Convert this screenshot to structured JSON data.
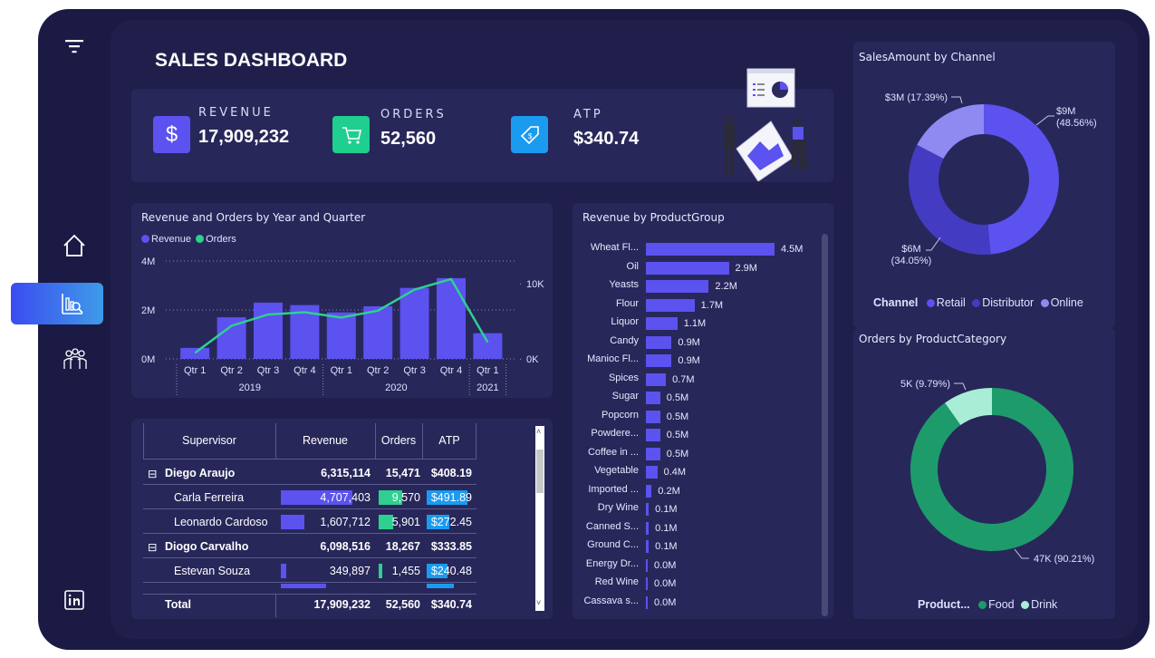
{
  "title": "SALES DASHBOARD",
  "kpis": [
    {
      "label": "REVENUE",
      "value": "17,909,232",
      "icon": "dollar-icon",
      "color": "#5b52f0"
    },
    {
      "label": "ORDERS",
      "value": "52,560",
      "icon": "cart-icon",
      "color": "#1fcf8f"
    },
    {
      "label": "ATP",
      "value": "$340.74",
      "icon": "price-tag-icon",
      "color": "#1a9bf0"
    }
  ],
  "colors": {
    "revenue": "#5b52f0",
    "orders": "#2fd08f",
    "food": "#1e9b6b",
    "drink": "#a8eed6",
    "retail": "#5b52f0",
    "distributor": "#433cc2",
    "online": "#8f8af2"
  },
  "combo": {
    "title": "Revenue and Orders by Year and Quarter",
    "legend": [
      "Revenue",
      "Orders"
    ],
    "left_axis": [
      "4M",
      "2M",
      "0M"
    ],
    "right_axis": [
      "10K",
      "0K"
    ],
    "quarters": [
      "Qtr 1",
      "Qtr 2",
      "Qtr 3",
      "Qtr 4",
      "Qtr 1",
      "Qtr 2",
      "Qtr 3",
      "Qtr 4",
      "Qtr 1"
    ],
    "years": [
      "2019",
      "2020",
      "2021"
    ]
  },
  "chart_data": [
    {
      "type": "bar",
      "title": "Revenue and Orders by Year and Quarter",
      "categories": [
        "2019 Qtr 1",
        "2019 Qtr 2",
        "2019 Qtr 3",
        "2019 Qtr 4",
        "2020 Qtr 1",
        "2020 Qtr 2",
        "2020 Qtr 3",
        "2020 Qtr 4",
        "2021 Qtr 1"
      ],
      "series": [
        {
          "name": "Revenue",
          "values": [
            450000,
            1700000,
            2300000,
            2200000,
            1900000,
            2150000,
            2900000,
            3300000,
            1050000
          ]
        },
        {
          "name": "Orders",
          "values": [
            800,
            4400,
            5900,
            6200,
            5500,
            6400,
            9200,
            10600,
            2200
          ]
        }
      ],
      "ylim": [
        0,
        4000000
      ],
      "y2lim": [
        0,
        13000
      ]
    },
    {
      "type": "bar",
      "title": "Revenue by ProductGroup",
      "categories": [
        "Wheat Fl...",
        "Oil",
        "Yeasts",
        "Flour",
        "Liquor",
        "Candy",
        "Manioc Fl...",
        "Spices",
        "Sugar",
        "Popcorn",
        "Powdere...",
        "Coffee in ...",
        "Vegetable",
        "Imported ...",
        "Dry Wine",
        "Canned S...",
        "Ground C...",
        "Energy Dr...",
        "Red Wine",
        "Cassava s..."
      ],
      "values": [
        4.5,
        2.9,
        2.2,
        1.7,
        1.1,
        0.9,
        0.9,
        0.7,
        0.5,
        0.5,
        0.5,
        0.5,
        0.4,
        0.2,
        0.1,
        0.1,
        0.1,
        0.0,
        0.0,
        0.0
      ],
      "labels": [
        "4.5M",
        "2.9M",
        "2.2M",
        "1.7M",
        "1.1M",
        "0.9M",
        "0.9M",
        "0.7M",
        "0.5M",
        "0.5M",
        "0.5M",
        "0.5M",
        "0.4M",
        "0.2M",
        "0.1M",
        "0.1M",
        "0.1M",
        "0.0M",
        "0.0M",
        "0.0M"
      ]
    },
    {
      "type": "pie",
      "title": "SalesAmount by Channel",
      "categories": [
        "Retail",
        "Distributor",
        "Online"
      ],
      "values": [
        48.56,
        34.05,
        17.39
      ],
      "labels": [
        "$9M (48.56%)",
        "$6M (34.05%)",
        "$3M (17.39%)"
      ],
      "legend_title": "Channel"
    },
    {
      "type": "pie",
      "title": "Orders by ProductCategory",
      "categories": [
        "Food",
        "Drink"
      ],
      "values": [
        90.21,
        9.79
      ],
      "labels": [
        "47K (90.21%)",
        "5K (9.79%)"
      ],
      "legend_title": "Product..."
    }
  ],
  "table": {
    "headers": [
      "Supervisor",
      "Revenue",
      "Orders",
      "ATP"
    ],
    "rows": [
      {
        "name": "Diego Araujo",
        "revenue": "6,315,114",
        "orders": "15,471",
        "atp": "$408.19",
        "group": true,
        "r": 0,
        "o": 0,
        "a": 0
      },
      {
        "name": "Carla Ferreira",
        "revenue": "4,707,403",
        "orders": "9,570",
        "atp": "$491.89",
        "group": false,
        "r": 0.72,
        "o": 0.72,
        "a": 0.9
      },
      {
        "name": "Leonardo Cardoso",
        "revenue": "1,607,712",
        "orders": "5,901",
        "atp": "$272.45",
        "group": false,
        "r": 0.24,
        "o": 0.44,
        "a": 0.5
      },
      {
        "name": "Diogo Carvalho",
        "revenue": "6,098,516",
        "orders": "18,267",
        "atp": "$333.85",
        "group": true,
        "r": 0,
        "o": 0,
        "a": 0
      },
      {
        "name": "Estevan Souza",
        "revenue": "349,897",
        "orders": "1,455",
        "atp": "$240.48",
        "group": false,
        "r": 0.05,
        "o": 0.11,
        "a": 0.45
      }
    ],
    "total": {
      "label": "Total",
      "revenue": "17,909,232",
      "orders": "52,560",
      "atp": "$340.74"
    }
  },
  "nav": [
    "filter-icon",
    "home-icon",
    "report-search-icon",
    "team-icon",
    "linkedin-icon"
  ]
}
